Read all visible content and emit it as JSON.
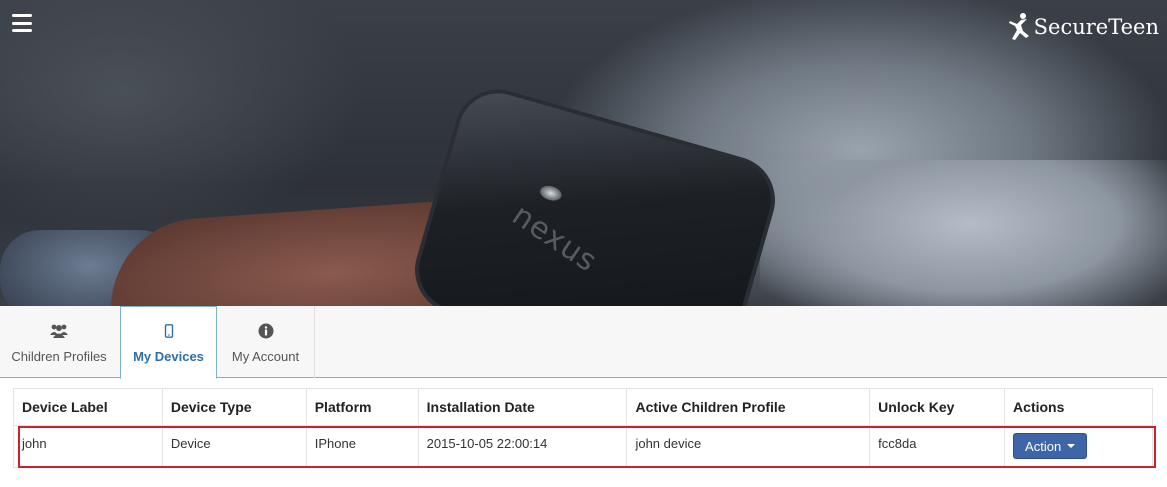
{
  "header": {
    "logo_text": "SecureTeen",
    "colors": {
      "logo": "#ffffff"
    }
  },
  "tabs": [
    {
      "label": "Children Profiles",
      "icon": "users-icon",
      "active": false
    },
    {
      "label": "My Devices",
      "icon": "mobile-icon",
      "active": true
    },
    {
      "label": "My Account",
      "icon": "info-icon",
      "active": false
    }
  ],
  "table": {
    "columns": [
      "Device Label",
      "Device Type",
      "Platform",
      "Installation Date",
      "Active Children Profile",
      "Unlock Key",
      "Actions"
    ],
    "rows": [
      {
        "device_label": "john",
        "device_type": "Device",
        "platform": "IPhone",
        "installation_date": "2015-10-05 22:00:14",
        "active_children_profile": "john device",
        "unlock_key": "fcc8da",
        "action_label": "Action"
      }
    ]
  },
  "colors": {
    "active_tab": "#2f6fa8",
    "action_button": "#3f65a9",
    "highlight": "#c8232c"
  }
}
